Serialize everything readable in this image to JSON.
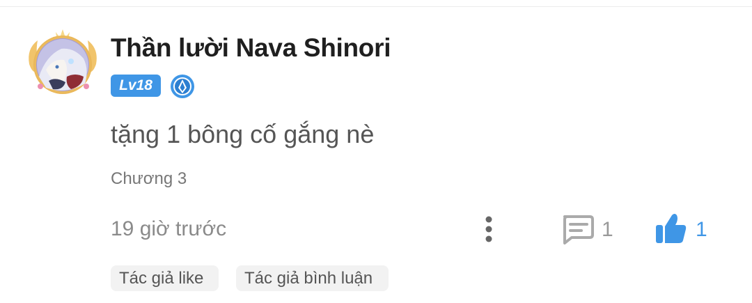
{
  "comment": {
    "user": {
      "name": "Thần lười Nava Shinori",
      "level": "Lv18",
      "avatar_icon": "avatar-icon",
      "rank_icon": "rank-medal-icon"
    },
    "text": "tặng 1 bông cố gắng nè",
    "chapter": "Chương 3",
    "time": "19 giờ trước",
    "reply_count": "1",
    "like_count": "1",
    "tags": [
      "Tác giả like",
      "Tác giả bình luận"
    ]
  },
  "colors": {
    "accent": "#3f96e6",
    "text_dark": "#1f1f1f",
    "text_muted": "#8a8a8a",
    "tag_bg": "#f2f2f2"
  }
}
